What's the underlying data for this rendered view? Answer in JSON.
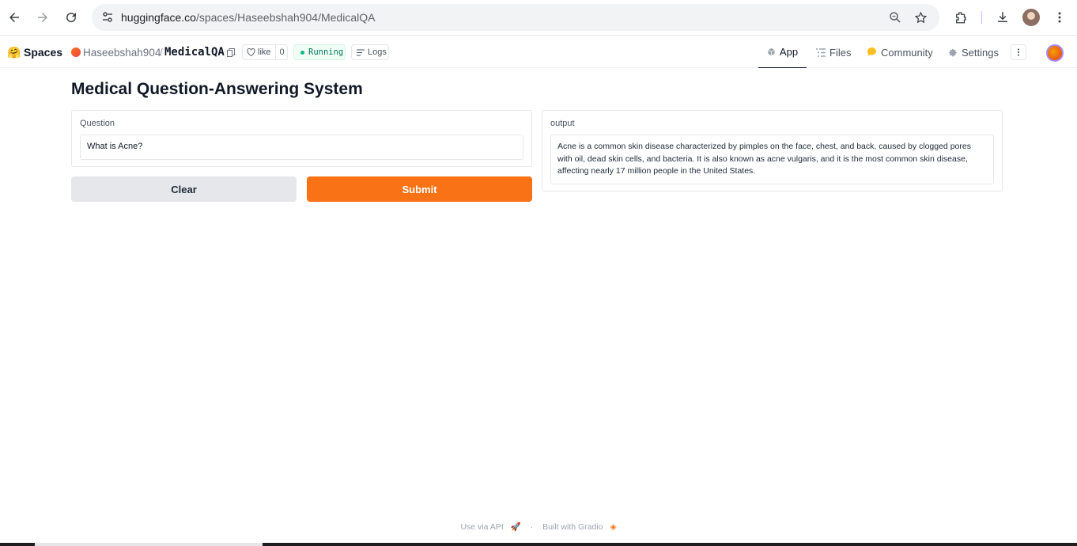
{
  "browser": {
    "url_host": "huggingface.co",
    "url_path": "/spaces/Haseebshah904/MedicalQA"
  },
  "hf_header": {
    "spaces_label": "Spaces",
    "owner": "Haseebshah904",
    "separator": "/",
    "repo": "MedicalQA",
    "like_label": "like",
    "like_count": "0",
    "status": "Running",
    "logs_label": "Logs",
    "tabs": [
      {
        "label": "App",
        "icon": "cube-icon",
        "active": true
      },
      {
        "label": "Files",
        "icon": "files-icon",
        "active": false
      },
      {
        "label": "Community",
        "icon": "community-icon",
        "active": false
      },
      {
        "label": "Settings",
        "icon": "gear-icon",
        "active": false
      }
    ]
  },
  "app": {
    "title": "Medical Question-Answering System",
    "question_label": "Question",
    "question_value": "What is Acne?",
    "output_label": "output",
    "output_value": "Acne is a common skin disease characterized by pimples on the face, chest, and back, caused by clogged pores with oil, dead skin cells, and bacteria. It is also known as acne vulgaris, and it is the most common skin disease, affecting nearly 17 million people in the United States.",
    "clear_label": "Clear",
    "submit_label": "Submit"
  },
  "footer": {
    "api_label": "Use via API",
    "separator": "·",
    "built_label": "Built with Gradio"
  },
  "colors": {
    "accent": "#f97316",
    "running": "#10b981"
  }
}
